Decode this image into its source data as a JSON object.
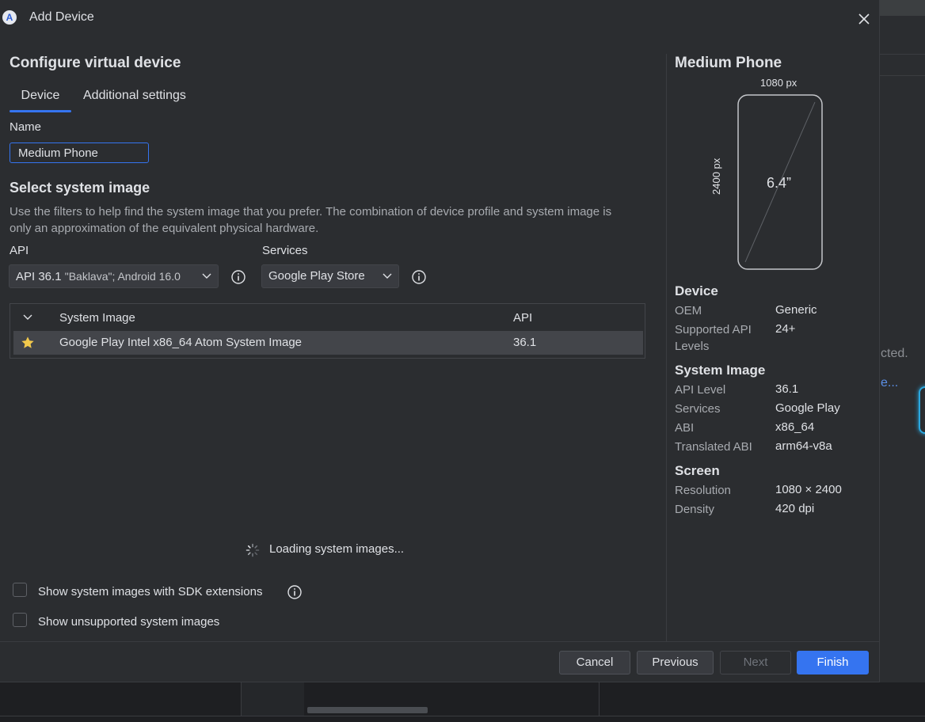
{
  "background": {
    "partial_text_1": "cted.",
    "partial_text_2": "e..."
  },
  "dialog": {
    "title": "Add Device",
    "app_icon_letter": "A"
  },
  "configure": {
    "heading": "Configure virtual device",
    "tabs": [
      {
        "label": "Device",
        "selected": true
      },
      {
        "label": "Additional settings",
        "selected": false
      }
    ],
    "name_label": "Name",
    "name_value": "Medium Phone"
  },
  "system_image": {
    "heading": "Select system image",
    "description": "Use the filters to help find the system image that you prefer. The combination of device profile and system image is only an approximation of the equivalent physical hardware.",
    "api_label": "API",
    "api_value": "API 36.1",
    "api_value_sub": "\"Baklava\"; Android 16.0",
    "services_label": "Services",
    "services_value": "Google Play Store",
    "table": {
      "columns": [
        "System Image",
        "API"
      ],
      "rows": [
        {
          "name": "Google Play Intel x86_64 Atom System Image",
          "api": "36.1",
          "starred": true
        }
      ]
    },
    "loading_text": "Loading system images...",
    "checkbox_sdk_extensions": "Show system images with SDK extensions",
    "checkbox_unsupported": "Show unsupported system images"
  },
  "preview": {
    "title": "Medium Phone",
    "width_label": "1080 px",
    "height_label": "2400 px",
    "size_label": "6.4”",
    "device_heading": "Device",
    "device_specs": [
      {
        "key": "OEM",
        "value": "Generic"
      },
      {
        "key": "Supported API Levels",
        "value": "24+"
      }
    ],
    "system_image_heading": "System Image",
    "system_image_specs": [
      {
        "key": "API Level",
        "value": "36.1"
      },
      {
        "key": "Services",
        "value": "Google Play"
      },
      {
        "key": "ABI",
        "value": "x86_64"
      },
      {
        "key": "Translated ABI",
        "value": "arm64-v8a"
      }
    ],
    "screen_heading": "Screen",
    "screen_specs": [
      {
        "key": "Resolution",
        "value": "1080 × 2400"
      },
      {
        "key": "Density",
        "value": "420 dpi"
      }
    ]
  },
  "buttons": {
    "cancel": "Cancel",
    "previous": "Previous",
    "next": "Next",
    "finish": "Finish"
  },
  "colors": {
    "accent": "#3574f0",
    "dialog_bg": "#2b2d30",
    "star": "#f2c94c"
  }
}
